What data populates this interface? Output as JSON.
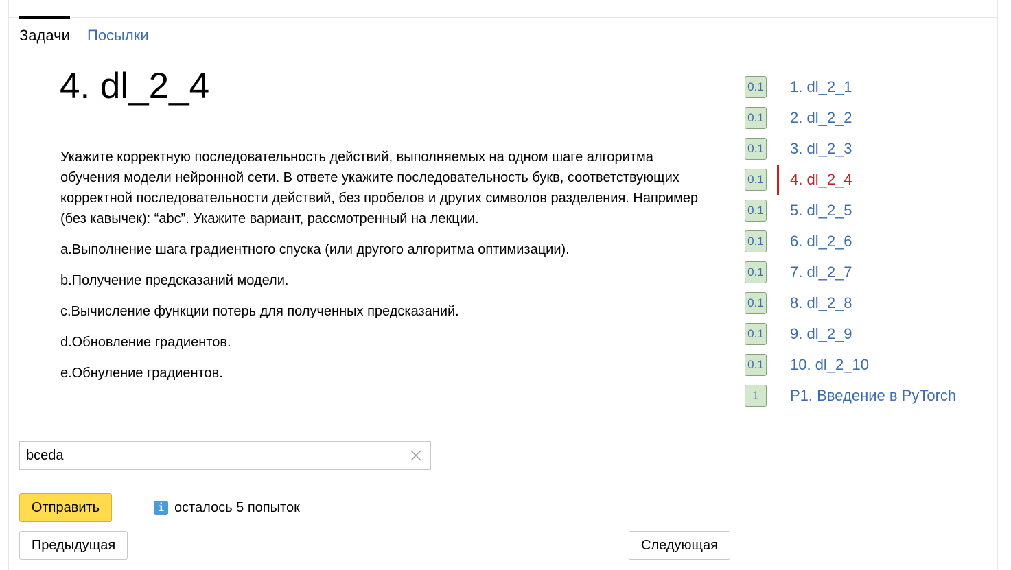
{
  "tabs": [
    {
      "label": "Задачи",
      "active": true
    },
    {
      "label": "Посылки",
      "active": false
    }
  ],
  "problem": {
    "title": "4. dl_2_4",
    "statement": [
      "Укажите корректную последовательность действий, выполняемых на одном шаге алгоритма обучения модели нейронной сети. В ответе укажите последовательность букв, соответствующих корректной последовательности действий, без пробелов и других символов разделения. Например (без кавычек): “abc”. Укажите вариант, рассмотренный на лекции.",
      "a.Выполнение шага градиентного спуска (или другого алгоритма оптимизации).",
      "b.Получение предсказаний модели.",
      "c.Вычисление функции потерь для полученных предсказаний.",
      "d.Обновление градиентов.",
      "e.Обнуление градиентов."
    ]
  },
  "task_list": [
    {
      "score": "0.1",
      "name": "1. dl_2_1"
    },
    {
      "score": "0.1",
      "name": "2. dl_2_2"
    },
    {
      "score": "0.1",
      "name": "3. dl_2_3"
    },
    {
      "score": "0.1",
      "name": "4. dl_2_4",
      "current": true
    },
    {
      "score": "0.1",
      "name": "5. dl_2_5"
    },
    {
      "score": "0.1",
      "name": "6. dl_2_6"
    },
    {
      "score": "0.1",
      "name": "7. dl_2_7"
    },
    {
      "score": "0.1",
      "name": "8. dl_2_8"
    },
    {
      "score": "0.1",
      "name": "9. dl_2_9"
    },
    {
      "score": "0.1",
      "name": "10. dl_2_10"
    },
    {
      "score": "1",
      "name": "P1. Введение в PyTorch"
    }
  ],
  "answer": {
    "value": "bceda",
    "clear_icon": "close-icon"
  },
  "actions": {
    "submit_label": "Отправить",
    "attempts_icon": "info-icon",
    "attempts_glyph": "i",
    "attempts_text": "осталось 5 попыток",
    "prev_label": "Предыдущая",
    "next_label": "Следующая"
  },
  "colors": {
    "link": "#3c6db0",
    "current": "#cc1f1f",
    "submit_bg": "#ffdb4d",
    "score_bg": "#d3e7cd",
    "info_bg": "#4a9bd6"
  }
}
